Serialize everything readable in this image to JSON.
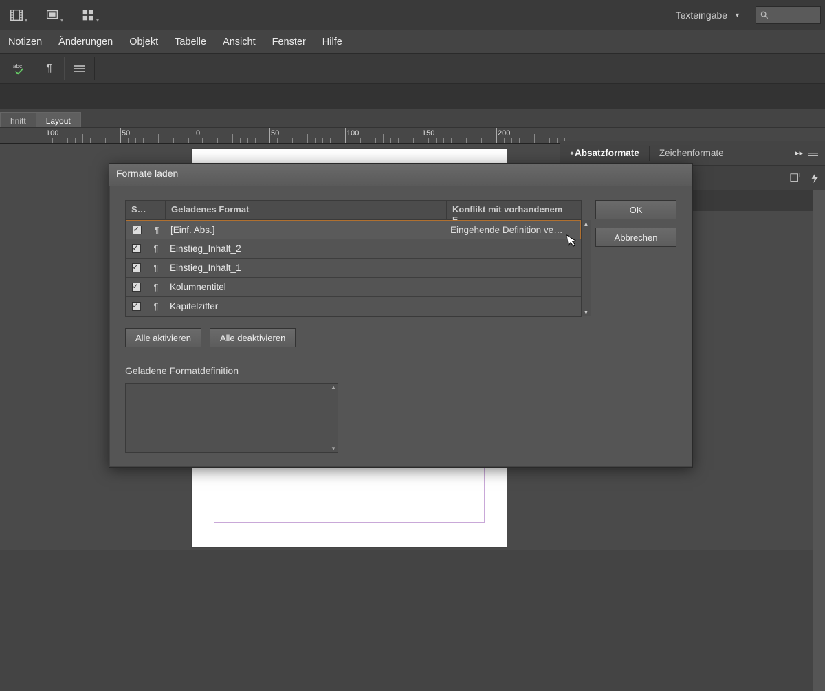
{
  "toolbar": {
    "dropdown_label": "Texteingabe"
  },
  "menu": {
    "items": [
      "Notizen",
      "Änderungen",
      "Objekt",
      "Tabelle",
      "Ansicht",
      "Fenster",
      "Hilfe"
    ]
  },
  "doc_tabs": {
    "items": [
      "hnitt",
      "Layout"
    ],
    "active": 1
  },
  "ruler": {
    "ticks": [
      {
        "pos": 65,
        "label": "100"
      },
      {
        "pos": 175,
        "label": "50"
      },
      {
        "pos": 283,
        "label": "0"
      },
      {
        "pos": 392,
        "label": "50"
      },
      {
        "pos": 502,
        "label": "100"
      },
      {
        "pos": 612,
        "label": "150"
      },
      {
        "pos": 722,
        "label": "200"
      }
    ]
  },
  "panel": {
    "tab1": "Absatzformate",
    "tab2": "Zeichenformate"
  },
  "dialog": {
    "title": "Formate laden",
    "headers": {
      "col_check": "S…",
      "col_name": "Geladenes Format",
      "col_conflict": "Konflikt mit vorhandenem F…"
    },
    "rows": [
      {
        "name": "[Einf. Abs.]",
        "conflict": "Eingehende Definition ve…",
        "selected": true
      },
      {
        "name": "Einstieg_Inhalt_2",
        "conflict": ""
      },
      {
        "name": "Einstieg_Inhalt_1",
        "conflict": ""
      },
      {
        "name": "Kolumnentitel",
        "conflict": ""
      },
      {
        "name": "Kapitelziffer",
        "conflict": ""
      }
    ],
    "activate_all": "Alle aktivieren",
    "deactivate_all": "Alle deaktivieren",
    "def_label": "Geladene Formatdefinition",
    "ok": "OK",
    "cancel": "Abbrechen"
  },
  "icons": {
    "pilcrow": "¶"
  }
}
